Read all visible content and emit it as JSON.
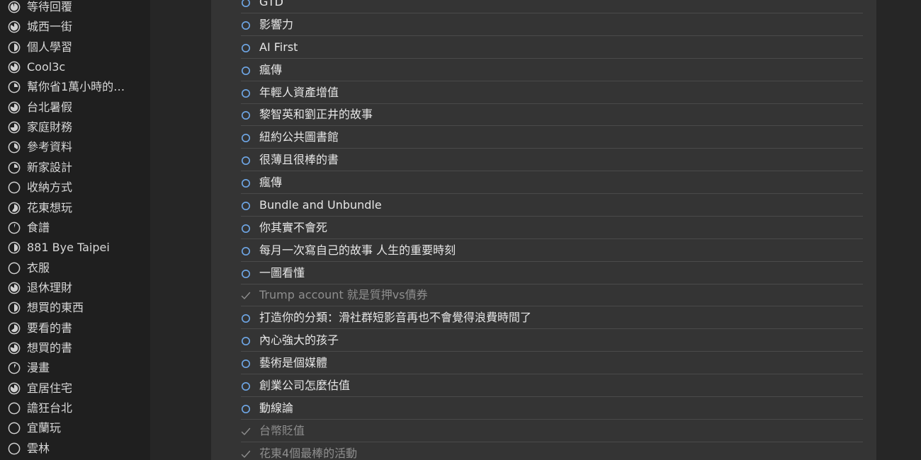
{
  "sidebar": {
    "projects": [
      {
        "label": "等待回覆",
        "icon": "progress-pie-icon",
        "progress": 0.95
      },
      {
        "label": "城西一街",
        "icon": "progress-pie-icon",
        "progress": 0.85
      },
      {
        "label": "個人學習",
        "icon": "progress-pie-icon",
        "progress": 0.5
      },
      {
        "label": "Cool3c",
        "icon": "progress-pie-icon",
        "progress": 0.85
      },
      {
        "label": "幫你省1萬小時的…",
        "icon": "progress-pie-icon",
        "progress": 0.25
      },
      {
        "label": "台北暑假",
        "icon": "progress-pie-icon",
        "progress": 0.8
      },
      {
        "label": "家庭財務",
        "icon": "progress-pie-icon",
        "progress": 0.75
      },
      {
        "label": "參考資料",
        "icon": "progress-pie-icon",
        "progress": 0.35
      },
      {
        "label": "新家設計",
        "icon": "progress-pie-icon",
        "progress": 0.25
      },
      {
        "label": "收納方式",
        "icon": "progress-pie-icon",
        "progress": 0.0
      },
      {
        "label": "花東想玩",
        "icon": "progress-pie-icon",
        "progress": 0.6
      },
      {
        "label": "食譜",
        "icon": "progress-pie-icon",
        "progress": 0.05
      },
      {
        "label": "881 Bye Taipei",
        "icon": "progress-pie-icon",
        "progress": 0.5
      },
      {
        "label": "衣服",
        "icon": "progress-pie-icon",
        "progress": 0.0
      },
      {
        "label": "退休理財",
        "icon": "progress-pie-icon",
        "progress": 0.85
      },
      {
        "label": "想買的東西",
        "icon": "progress-pie-icon",
        "progress": 0.5
      },
      {
        "label": "要看的書",
        "icon": "progress-pie-icon",
        "progress": 0.65
      },
      {
        "label": "想買的書",
        "icon": "progress-pie-icon",
        "progress": 0.8
      },
      {
        "label": "漫畫",
        "icon": "progress-pie-icon",
        "progress": 0.08
      },
      {
        "label": "宜居住宅",
        "icon": "progress-pie-icon",
        "progress": 0.85
      },
      {
        "label": "譫狂台北",
        "icon": "progress-pie-icon",
        "progress": 0.0
      },
      {
        "label": "宜蘭玩",
        "icon": "progress-pie-icon",
        "progress": 0.0
      },
      {
        "label": "雲林",
        "icon": "progress-pie-icon",
        "progress": 0.0
      }
    ]
  },
  "tasks": [
    {
      "label": "GTD",
      "done": false
    },
    {
      "label": "影響力",
      "done": false
    },
    {
      "label": "AI First",
      "done": false
    },
    {
      "label": "瘋傳",
      "done": false
    },
    {
      "label": "年輕人資產增值",
      "done": false
    },
    {
      "label": "黎智英和劉正井的故事",
      "done": false
    },
    {
      "label": "紐約公共圖書館",
      "done": false
    },
    {
      "label": "很薄且很棒的書",
      "done": false
    },
    {
      "label": "瘋傳",
      "done": false
    },
    {
      "label": "Bundle and Unbundle",
      "done": false
    },
    {
      "label": "你其實不會死",
      "done": false
    },
    {
      "label": "每月一次寫自己的故事 人生的重要時刻",
      "done": false
    },
    {
      "label": "一圖看懂",
      "done": false
    },
    {
      "label": "Trump account 就是質押vs債券",
      "done": true
    },
    {
      "label": "打造你的分類：滑社群短影音再也不會覺得浪費時間了",
      "done": false
    },
    {
      "label": "內心強大的孩子",
      "done": false
    },
    {
      "label": "藝術是個媒體",
      "done": false
    },
    {
      "label": "創業公司怎麼估值",
      "done": false
    },
    {
      "label": "動線論",
      "done": false
    },
    {
      "label": "台幣貶值",
      "done": true
    },
    {
      "label": "花東4個最棒的活動",
      "done": true
    }
  ],
  "colors": {
    "open_circle": "#6fa8e8",
    "check": "#8e8e8e",
    "pie": "#cfcfcf"
  }
}
